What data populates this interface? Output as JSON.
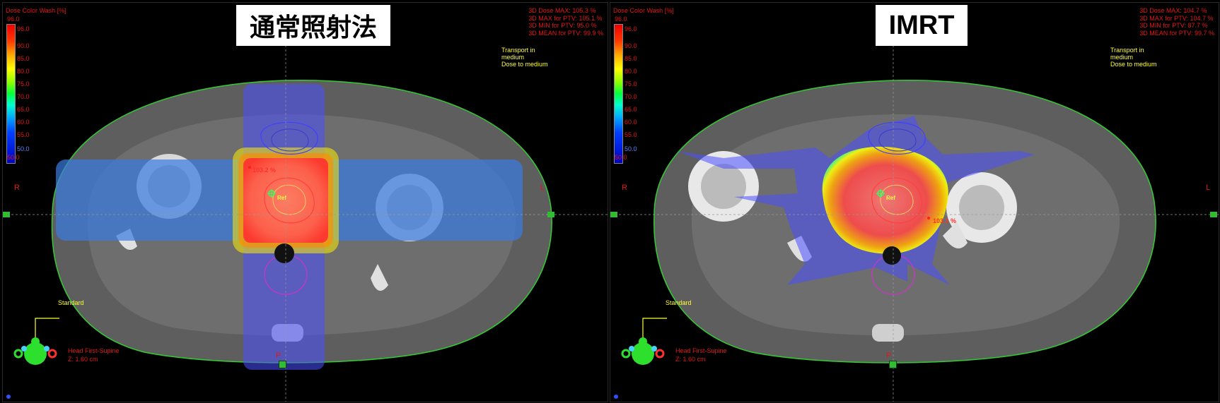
{
  "panels": [
    {
      "title": "通常照射法",
      "colorbar": {
        "title": "Dose Color Wash [%]",
        "max": "96.0",
        "ticks": [
          "90.0",
          "85.0",
          "80.0",
          "75.0",
          "70.0",
          "65.0",
          "60.0",
          "55.0"
        ],
        "low": "50.0",
        "min": "50.0"
      },
      "stats": [
        "3D Dose MAX: 105.3 %",
        "3D MAX for PTV: 105.1 %",
        "3D MIN for PTV: 95.0 %",
        "3D MEAN for PTV: 99.9 %"
      ],
      "transport": [
        "Transport in",
        "medium",
        "Dose to medium"
      ],
      "orient": {
        "right": "R",
        "left": "L",
        "bottom": "P"
      },
      "hotspot_label": "103.2 %",
      "ref_label": "Ref",
      "view_label": "Standard",
      "patient_position": "Head First-Supine",
      "slice": "Z: 1.60 cm"
    },
    {
      "title": "IMRT",
      "colorbar": {
        "title": "Dose Color Wash [%]",
        "max": "96.0",
        "ticks": [
          "90.0",
          "85.0",
          "80.0",
          "75.0",
          "70.0",
          "65.0",
          "60.0",
          "55.0"
        ],
        "low": "50.0",
        "min": "50.0"
      },
      "stats": [
        "3D Dose MAX: 104.7 %",
        "3D MAX for PTV: 104.7 %",
        "3D MIN for PTV: 87.7 %",
        "3D MEAN for PTV: 99.7 %"
      ],
      "transport": [
        "Transport in",
        "medium",
        "Dose to medium"
      ],
      "orient": {
        "right": "R",
        "left": "L",
        "bottom": "P"
      },
      "hotspot_label": "103.1 %",
      "ref_label": "Ref",
      "view_label": "Standard",
      "patient_position": "Head First-Supine",
      "slice": "Z: 1.60 cm"
    }
  ],
  "colors": {
    "label_red": "#e01818",
    "label_yellow": "#ffff33",
    "body_contour": "#33cc33",
    "ptv_contour": "#ff4040",
    "bladder_contour": "#4040ff",
    "rectum_contour": "#cc33cc",
    "low_dose_wash": "#4a50ff"
  }
}
